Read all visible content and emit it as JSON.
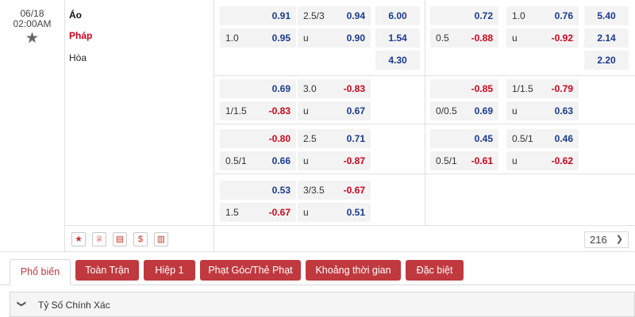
{
  "match": {
    "date": "06/18",
    "time": "02:00AM",
    "teams": {
      "home": "Áo",
      "away": "Pháp",
      "draw": "Hòa"
    }
  },
  "odds": {
    "row1": {
      "ft_hdp_top": "0.91",
      "ft_hdp_line": "1.0",
      "ft_hdp_bottom": "0.95",
      "ft_ou_line": "2.5/3",
      "ft_ou_top": "0.94",
      "ft_ou_u": "u",
      "ft_ou_bottom": "0.90",
      "ft_1x2": [
        "6.00",
        "1.54",
        "4.30"
      ],
      "h1_hdp_top": "0.72",
      "h1_hdp_line": "0.5",
      "h1_hdp_bottom": "-0.88",
      "h1_ou_line": "1.0",
      "h1_ou_top": "0.76",
      "h1_ou_u": "u",
      "h1_ou_bottom": "-0.92",
      "h1_1x2": [
        "5.40",
        "2.14",
        "2.20"
      ]
    },
    "row2": {
      "ft_hdp_top": "0.69",
      "ft_hdp_line": "1/1.5",
      "ft_hdp_bottom": "-0.83",
      "ft_ou_line": "3.0",
      "ft_ou_top": "-0.83",
      "ft_ou_u": "u",
      "ft_ou_bottom": "0.67",
      "h1_hdp_top": "-0.85",
      "h1_hdp_line": "0/0.5",
      "h1_hdp_bottom": "0.69",
      "h1_ou_line": "1/1.5",
      "h1_ou_top": "-0.79",
      "h1_ou_u": "u",
      "h1_ou_bottom": "0.63"
    },
    "row3": {
      "ft_hdp_top": "-0.80",
      "ft_hdp_line": "0.5/1",
      "ft_hdp_bottom": "0.66",
      "ft_ou_line": "2.5",
      "ft_ou_top": "0.71",
      "ft_ou_u": "u",
      "ft_ou_bottom": "-0.87",
      "h1_hdp_top": "0.45",
      "h1_hdp_line": "0.5/1",
      "h1_hdp_bottom": "-0.61",
      "h1_ou_line": "0.5/1",
      "h1_ou_top": "0.46",
      "h1_ou_u": "u",
      "h1_ou_bottom": "-0.62"
    },
    "row4": {
      "ft_hdp_top": "0.53",
      "ft_hdp_line": "1.5",
      "ft_hdp_bottom": "-0.67",
      "ft_ou_line": "3/3.5",
      "ft_ou_top": "-0.67",
      "ft_ou_u": "u",
      "ft_ou_bottom": "0.51"
    }
  },
  "footer": {
    "icons": [
      "star-icon",
      "trophy-icon",
      "ticket-icon",
      "dollar-icon",
      "stats-icon"
    ],
    "more_count": "216",
    "more_chevron": "❯"
  },
  "tabs": [
    "Phổ biến",
    "Toàn Trận",
    "Hiệp 1",
    "Phạt Góc/Thẻ Phạt",
    "Khoảng thời gian",
    "Đặc biệt"
  ],
  "section": {
    "title": "Tỷ Số Chính Xác",
    "chevron": "❯"
  },
  "colors": {
    "accent": "#c0393f",
    "positive": "#1a3a8f",
    "negative": "#d0021b"
  }
}
